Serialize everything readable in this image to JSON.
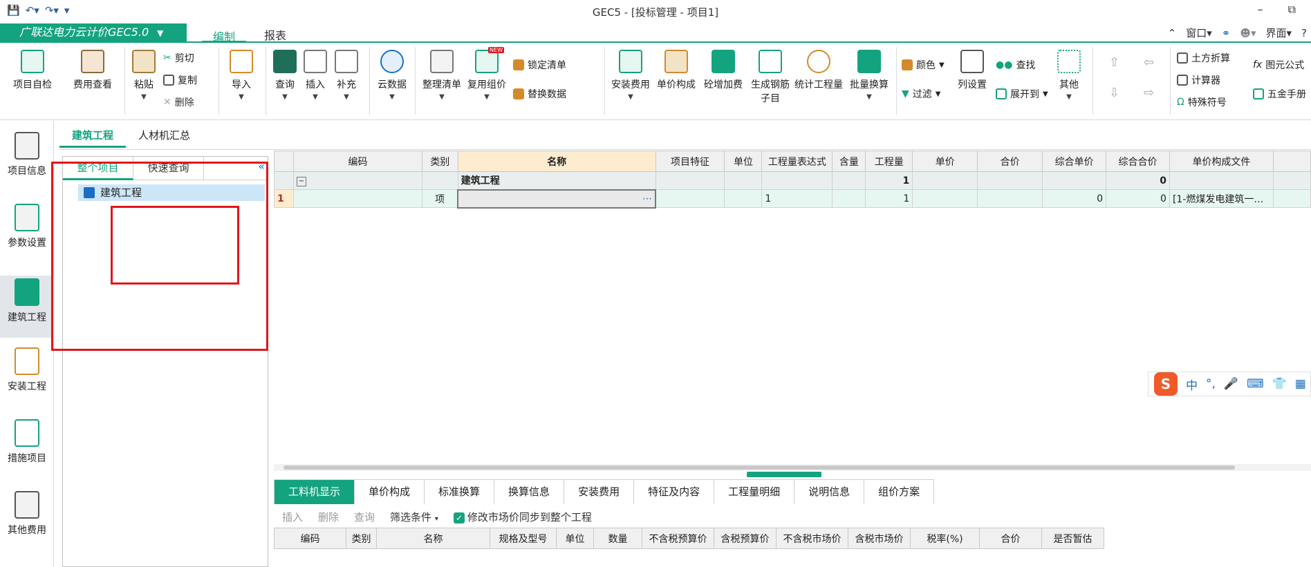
{
  "window": {
    "title": "GEC5 - [投标管理 - 项目1]"
  },
  "menubar": {
    "brand": "广联达电力云计价GEC5.0",
    "tabs": [
      "编制",
      "报表"
    ],
    "right": [
      "窗口",
      "界面"
    ]
  },
  "ribbon": {
    "self_check": "项目自检",
    "fee_view": "费用查看",
    "paste": "粘贴",
    "cut": "剪切",
    "copy": "复制",
    "delete": "删除",
    "import": "导入",
    "query": "查询",
    "insert": "插入",
    "supplement": "补充",
    "cloud_data": "云数据",
    "arrange_list": "整理清单",
    "reuse_group": "复用组价",
    "new_badge": "NEW",
    "lock_list": "锁定清单",
    "replace_data": "替换数据",
    "install_fee": "安装费用",
    "unit_compose": "单价构成",
    "concrete_fee": "砼增加费",
    "gen_rebar_1": "生成钢筋",
    "gen_rebar_2": "子目",
    "stat_qty": "统计工程量",
    "batch_convert": "批量换算",
    "color": "颜色",
    "filter": "过滤",
    "col_setting": "列设置",
    "find": "查找",
    "expand_to": "展开到",
    "others": "其他",
    "earthwork": "土方折算",
    "calculator": "计算器",
    "special_symbol": "特殊符号",
    "formula": "图元公式",
    "hardware_manual": "五金手册"
  },
  "leftnav": [
    "项目信息",
    "参数设置",
    "建筑工程",
    "安装工程",
    "措施项目",
    "其他费用"
  ],
  "subtabs": [
    "建筑工程",
    "人材机汇总"
  ],
  "tree": {
    "tabs": [
      "整个项目",
      "快速查询"
    ],
    "node": "建筑工程"
  },
  "grid": {
    "columns": [
      "编码",
      "类别",
      "名称",
      "项目特征",
      "单位",
      "工程量表达式",
      "含量",
      "工程量",
      "单价",
      "合价",
      "综合单价",
      "综合合价",
      "单价构成文件"
    ],
    "rows": [
      {
        "no": "",
        "code": "",
        "type": "",
        "name": "建筑工程",
        "feature": "",
        "unit": "",
        "expr": "",
        "content": "",
        "qty": "1",
        "price": "",
        "total": "",
        "comp_price": "",
        "comp_total": "0",
        "file": ""
      },
      {
        "no": "1",
        "code": "",
        "type": "项",
        "name": "",
        "feature": "",
        "unit": "",
        "expr": "1",
        "content": "",
        "qty": "1",
        "price": "",
        "total": "",
        "comp_price": "0",
        "comp_total": "0",
        "file": "[1-燃煤发电建筑一…"
      }
    ]
  },
  "ime": {
    "logo": "S",
    "lang": "中"
  },
  "bottom": {
    "tabs": [
      "工料机显示",
      "单价构成",
      "标准换算",
      "换算信息",
      "安装费用",
      "特征及内容",
      "工程量明细",
      "说明信息",
      "组价方案"
    ],
    "toolbar": {
      "insert": "插入",
      "delete": "删除",
      "query": "查询",
      "filter": "筛选条件",
      "sync": "修改市场价同步到整个工程"
    },
    "columns": [
      "编码",
      "类别",
      "名称",
      "规格及型号",
      "单位",
      "数量",
      "不含税预算价",
      "含税预算价",
      "不含税市场价",
      "含税市场价",
      "税率(%)",
      "合价",
      "是否暂估"
    ]
  },
  "colors": {
    "accent": "#14a37f",
    "highlight": "#e0161b"
  }
}
